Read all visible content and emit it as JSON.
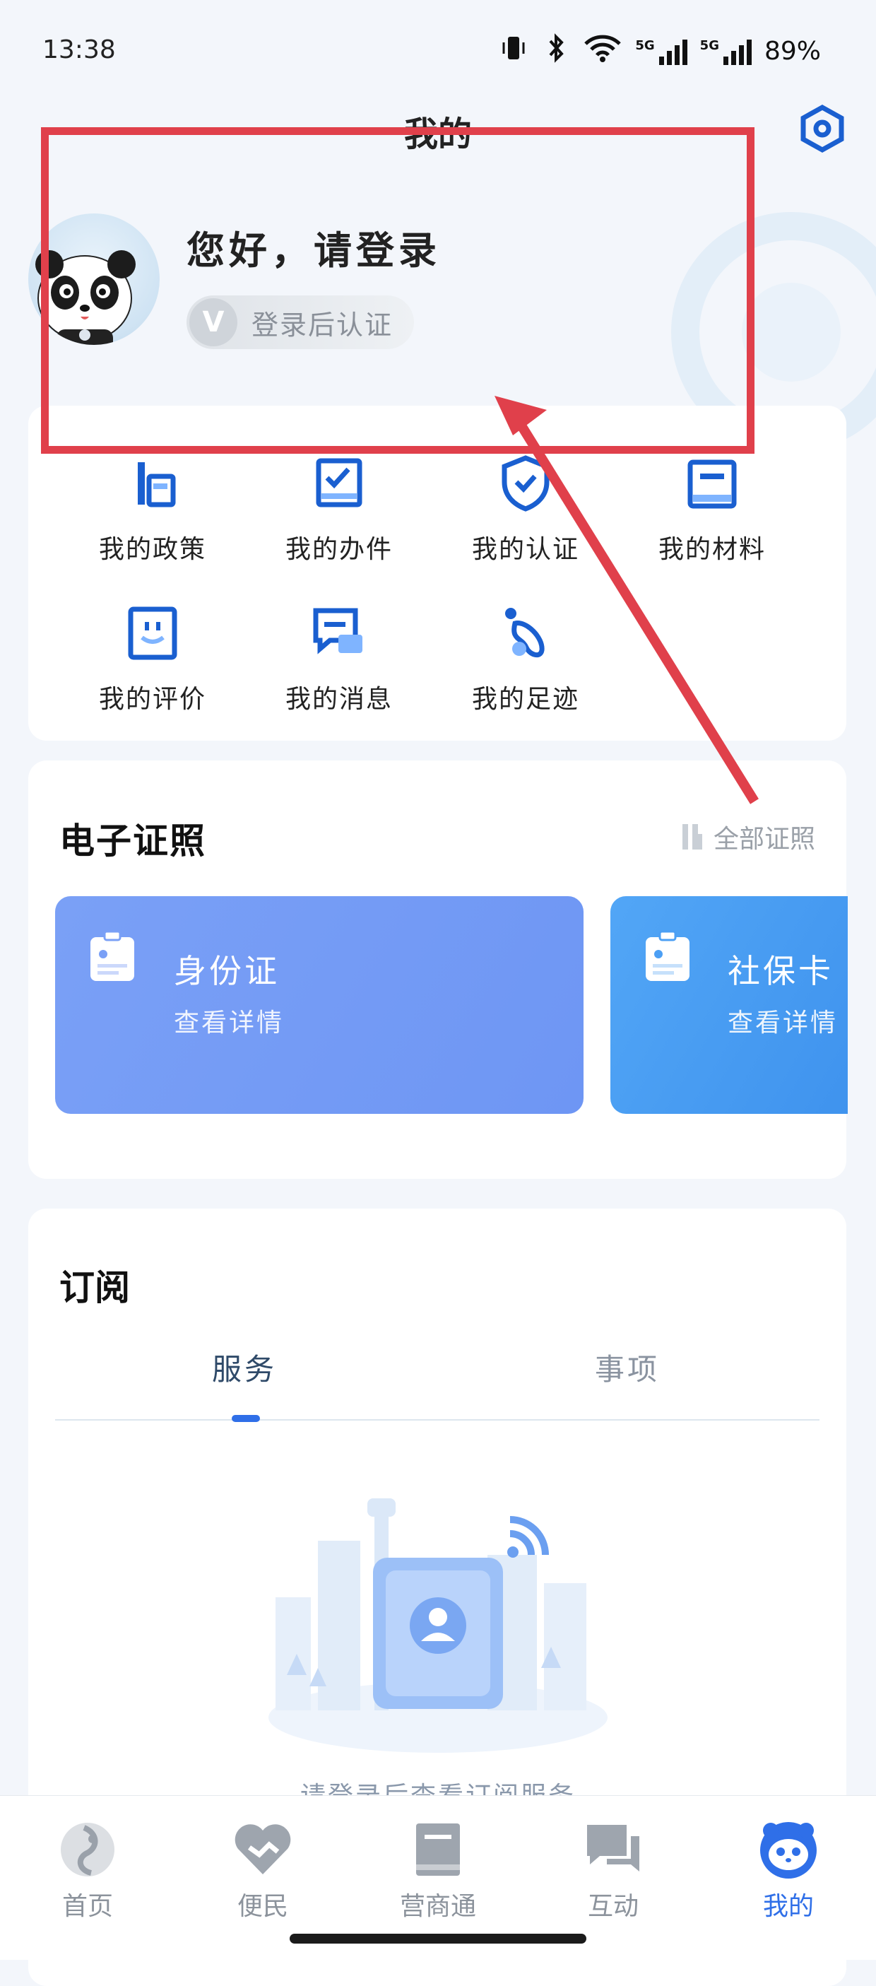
{
  "status_bar": {
    "time": "13:38",
    "battery": "89%",
    "network_label": "5G"
  },
  "header": {
    "title": "我的",
    "settings_icon": "gear-hex-icon"
  },
  "profile": {
    "greeting": "您好，请登录",
    "verify_label": "登录后认证",
    "verify_badge_letter": "V"
  },
  "menu": {
    "items": [
      {
        "label": "我的政策",
        "icon": "policy-icon"
      },
      {
        "label": "我的办件",
        "icon": "task-icon"
      },
      {
        "label": "我的认证",
        "icon": "shield-check-icon"
      },
      {
        "label": "我的材料",
        "icon": "folder-icon"
      },
      {
        "label": "我的评价",
        "icon": "smile-icon"
      },
      {
        "label": "我的消息",
        "icon": "message-icon"
      },
      {
        "label": "我的足迹",
        "icon": "footprint-icon"
      }
    ]
  },
  "licenses": {
    "title": "电子证照",
    "all_label": "全部证照",
    "cards": [
      {
        "name": "身份证",
        "sub": "查看详情"
      },
      {
        "name": "社保卡",
        "sub": "查看详情"
      }
    ]
  },
  "subscriptions": {
    "title": "订阅",
    "tabs": [
      {
        "label": "服务",
        "active": true
      },
      {
        "label": "事项",
        "active": false
      }
    ],
    "empty_text": "请登录后查看订阅服务"
  },
  "bottom_nav": {
    "items": [
      {
        "label": "首页",
        "icon": "home-logo-icon"
      },
      {
        "label": "便民",
        "icon": "heart-handshake-icon"
      },
      {
        "label": "营商通",
        "icon": "book-icon"
      },
      {
        "label": "互动",
        "icon": "chat-icon"
      },
      {
        "label": "我的",
        "icon": "panda-icon",
        "active": true
      }
    ]
  },
  "colors": {
    "accent": "#2f6fe8",
    "annotation": "#e0404b",
    "idcard": "#7aa0f6",
    "social": "#4c9ff4"
  }
}
